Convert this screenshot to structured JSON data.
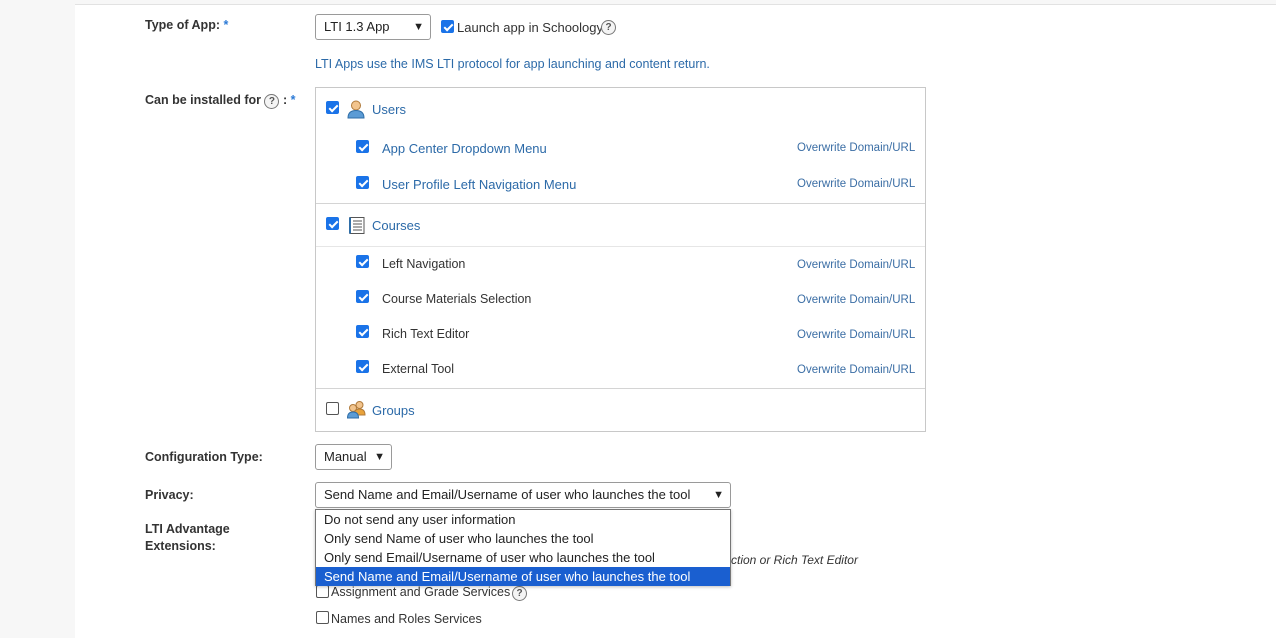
{
  "type_of_app": {
    "label": "Type of App:",
    "required": "*",
    "selected": "LTI 1.3 App",
    "launch_label": "Launch app in Schoology",
    "launch_checked": true,
    "help": "?",
    "info": "LTI Apps use the IMS LTI protocol for app launching and content return."
  },
  "installed_for": {
    "label": "Can be installed for",
    "help": "?",
    "suffix": ":",
    "required": "*",
    "overwrite_label": "Overwrite Domain/URL",
    "users": {
      "label": "Users",
      "checked": true,
      "icon": "user-icon",
      "items": [
        {
          "label": "App Center Dropdown Menu",
          "checked": true
        },
        {
          "label": "User Profile Left Navigation Menu",
          "checked": true
        }
      ]
    },
    "courses": {
      "label": "Courses",
      "checked": true,
      "icon": "notebook-icon",
      "items": [
        {
          "label": "Left Navigation",
          "checked": true
        },
        {
          "label": "Course Materials Selection",
          "checked": true
        },
        {
          "label": "Rich Text Editor",
          "checked": true
        },
        {
          "label": "External Tool",
          "checked": true
        }
      ]
    },
    "groups": {
      "label": "Groups",
      "checked": false,
      "icon": "group-icon"
    }
  },
  "configuration_type": {
    "label": "Configuration Type:",
    "selected": "Manual"
  },
  "privacy": {
    "label": "Privacy:",
    "selected": "Send Name and Email/Username of user who launches the tool",
    "options": [
      "Do not send any user information",
      "Only send Name of user who launches the tool",
      "Only send Email/Username of user who launches the tool",
      "Send Name and Email/Username of user who launches the tool"
    ]
  },
  "lti_advantage": {
    "label_line1": "LTI Advantage",
    "label_line2": "Extensions:",
    "partial_text": "ction or Rich Text Editor",
    "assignment": {
      "label": "Assignment and Grade Services",
      "checked": false,
      "help": "?"
    },
    "names_roles": {
      "label": "Names and Roles Services",
      "checked": false
    }
  },
  "colors": {
    "accent": "#1a73e8",
    "link": "#2c6aa8",
    "selected_option": "#1a5fd0"
  }
}
